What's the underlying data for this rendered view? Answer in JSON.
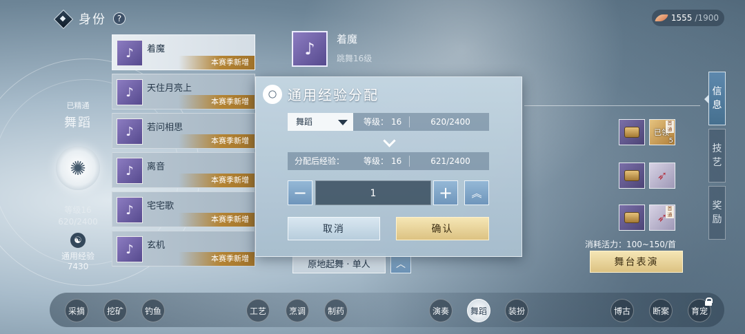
{
  "header": {
    "title": "身份",
    "help": "?"
  },
  "vitality": {
    "current": "1555",
    "max": "/1900"
  },
  "profile": {
    "mastered_label": "已精通",
    "skill_name": "舞蹈",
    "level": "等级16",
    "exp": "620/2400",
    "general_exp_label": "通用经验",
    "general_exp_value": "7430"
  },
  "songs": [
    {
      "name": "着魔",
      "badge": "本赛季新增"
    },
    {
      "name": "天住月亮上",
      "badge": "本赛季新增"
    },
    {
      "name": "若问相思",
      "badge": "本赛季新增"
    },
    {
      "name": "离音",
      "badge": "本赛季新增"
    },
    {
      "name": "宅宅歌",
      "badge": "本赛季新增"
    },
    {
      "name": "玄机",
      "badge": "本赛季新增"
    }
  ],
  "detail": {
    "name": "着魔",
    "subtitle": "跳舞16级",
    "mode": "原地起舞 · 单人",
    "consume": "消耗活力：100~150/首",
    "perform_button": "舞台表演"
  },
  "rewards": {
    "first_tag": "首通",
    "obtained": "已领",
    "count": "5"
  },
  "tabs": [
    "信息",
    "技艺",
    "奖励"
  ],
  "dialog": {
    "title": "通用经验分配",
    "selected_skill": "舞蹈",
    "level_label": "等级：",
    "level_value": "16",
    "current_exp": "620/2400",
    "after_label": "分配后经验：",
    "after_level_value": "16",
    "after_exp": "621/2400",
    "amount": "1",
    "cancel": "取消",
    "confirm": "确认"
  },
  "bottom_nav": [
    "采摘",
    "挖矿",
    "钓鱼",
    "工艺",
    "烹调",
    "制药",
    "演奏",
    "舞蹈",
    "装扮",
    "博古",
    "断案",
    "育宠"
  ]
}
